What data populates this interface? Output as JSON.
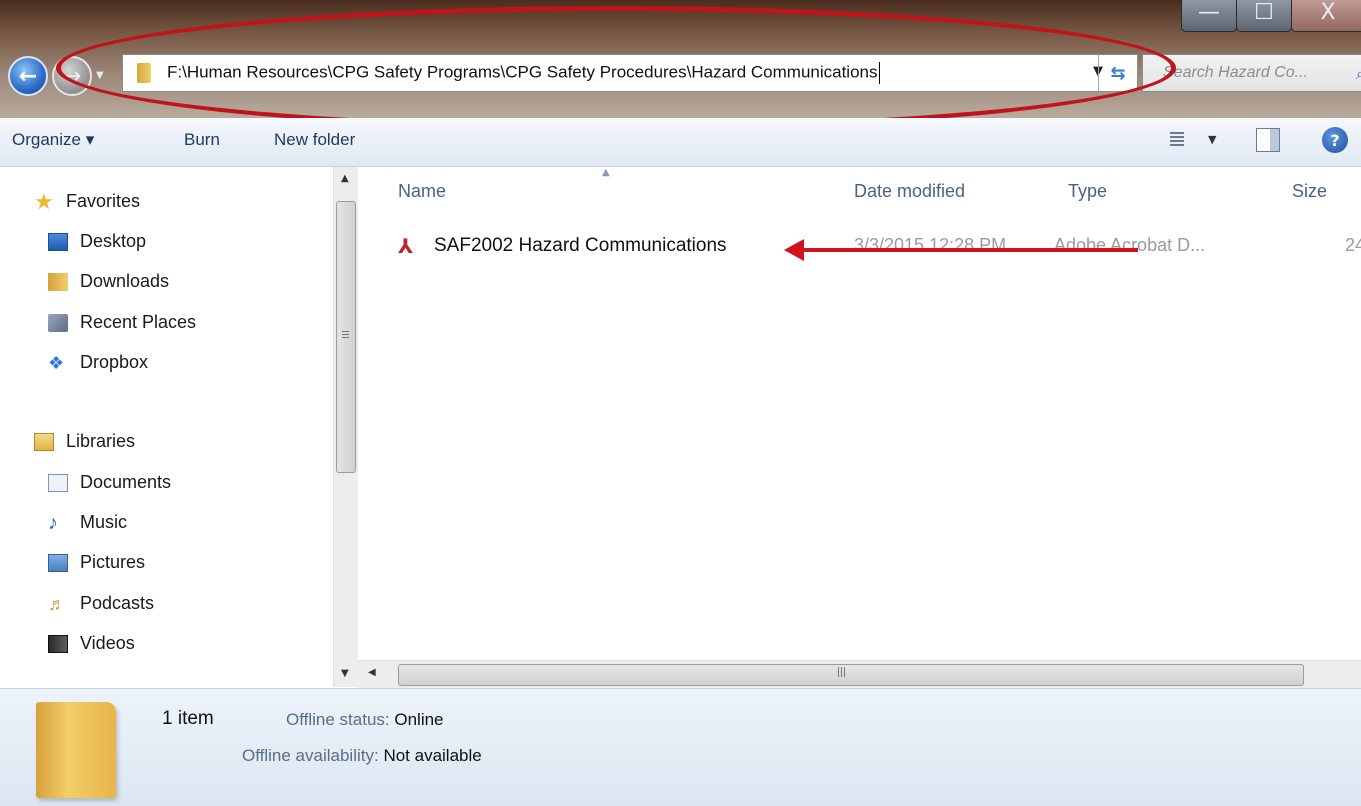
{
  "window": {
    "controls": {
      "minimize": "—",
      "maximize": "☐",
      "close": "X"
    }
  },
  "address_bar": {
    "path": "F:\\Human Resources\\CPG Safety Programs\\CPG Safety Procedures\\Hazard Communications"
  },
  "search": {
    "placeholder": "Search Hazard Co..."
  },
  "toolbar": {
    "organize": "Organize ▾",
    "burn": "Burn",
    "new_folder": "New folder"
  },
  "nav": {
    "favorites": [
      {
        "label": "Favorites",
        "icon": "star-icon"
      },
      {
        "label": "Desktop",
        "icon": "desktop-icon"
      },
      {
        "label": "Downloads",
        "icon": "downloads-folder-icon"
      },
      {
        "label": "Recent Places",
        "icon": "recent-places-icon"
      },
      {
        "label": "Dropbox",
        "icon": "dropbox-icon"
      }
    ],
    "libraries": [
      {
        "label": "Libraries",
        "icon": "libraries-icon"
      },
      {
        "label": "Documents",
        "icon": "documents-icon"
      },
      {
        "label": "Music",
        "icon": "music-icon"
      },
      {
        "label": "Pictures",
        "icon": "pictures-icon"
      },
      {
        "label": "Podcasts",
        "icon": "podcasts-icon"
      },
      {
        "label": "Videos",
        "icon": "videos-icon"
      }
    ]
  },
  "columns": {
    "name": "Name",
    "date_modified": "Date modified",
    "type": "Type",
    "size": "Size"
  },
  "files": [
    {
      "name": "SAF2002 Hazard Communications",
      "date_modified": "3/3/2015 12:28 PM",
      "type": "Adobe Acrobat D...",
      "size": "24",
      "icon": "pdf-file-icon"
    }
  ],
  "details": {
    "count": "1 item",
    "offline_status_label": "Offline status:",
    "offline_status_value": "Online",
    "offline_availability_label": "Offline availability:",
    "offline_availability_value": "Not available"
  },
  "annotations": {
    "highlight_color": "#c0141c",
    "arrow_color": "#d4121d"
  }
}
